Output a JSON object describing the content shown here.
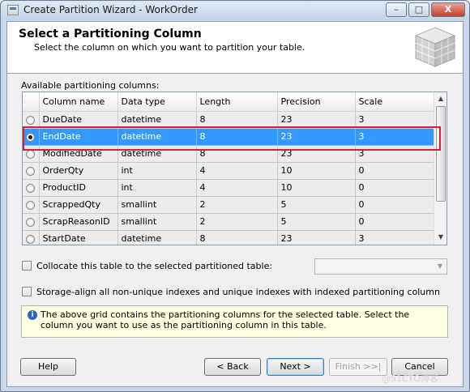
{
  "window": {
    "title": "Create Partition Wizard - WorkOrder",
    "min_glyph": "–",
    "max_glyph": "□",
    "close_glyph": "X"
  },
  "header": {
    "title": "Select a Partitioning Column",
    "subtitle": "Select the column on which you want to partition your table."
  },
  "grid": {
    "label": "Available partitioning columns:",
    "columns": [
      "Column name",
      "Data type",
      "Length",
      "Precision",
      "Scale"
    ],
    "rows": [
      {
        "name": "DueDate",
        "type": "datetime",
        "length": "8",
        "precision": "23",
        "scale": "3",
        "selected": false
      },
      {
        "name": "EndDate",
        "type": "datetime",
        "length": "8",
        "precision": "23",
        "scale": "3",
        "selected": true
      },
      {
        "name": "ModifiedDate",
        "type": "datetime",
        "length": "8",
        "precision": "23",
        "scale": "3",
        "selected": false
      },
      {
        "name": "OrderQty",
        "type": "int",
        "length": "4",
        "precision": "10",
        "scale": "0",
        "selected": false
      },
      {
        "name": "ProductID",
        "type": "int",
        "length": "4",
        "precision": "10",
        "scale": "0",
        "selected": false
      },
      {
        "name": "ScrappedQty",
        "type": "smallint",
        "length": "2",
        "precision": "5",
        "scale": "0",
        "selected": false
      },
      {
        "name": "ScrapReasonID",
        "type": "smallint",
        "length": "2",
        "precision": "5",
        "scale": "0",
        "selected": false
      },
      {
        "name": "StartDate",
        "type": "datetime",
        "length": "8",
        "precision": "23",
        "scale": "3",
        "selected": false
      }
    ]
  },
  "collocate": {
    "label": "Collocate this table to the selected partitioned table:",
    "checked": false,
    "value": ""
  },
  "storage_align": {
    "label": "Storage-align all non-unique indexes and unique indexes with indexed partitioning column",
    "checked": false
  },
  "info": {
    "icon": "info-icon",
    "text": "The above grid contains the partitioning columns for the selected table. Select the column you want to use as the partitioning column in this table."
  },
  "buttons": {
    "help": "Help",
    "back": "< Back",
    "next": "Next >",
    "finish": "Finish >>|",
    "cancel": "Cancel"
  },
  "watermark": "@51CTO博客",
  "colors": {
    "selection": "#3399ff",
    "highlight_box": "#d21f3c",
    "info_bg": "#ffffe1"
  }
}
